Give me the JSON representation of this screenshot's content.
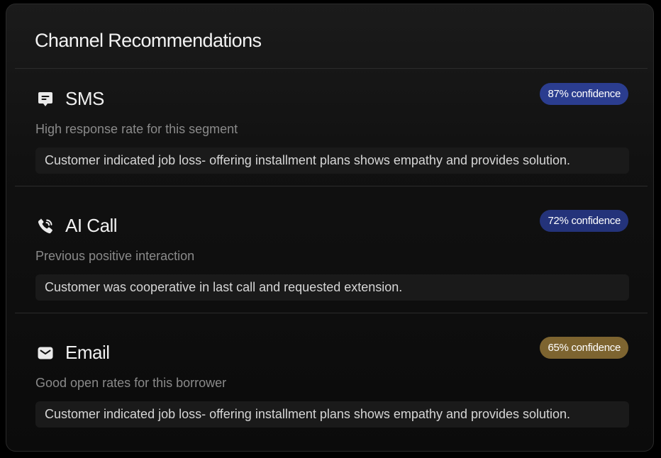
{
  "panel": {
    "title": "Channel Recommendations"
  },
  "recommendations": [
    {
      "channel": "SMS",
      "icon": "chat-bubble-icon",
      "confidence": "87% confidence",
      "confidence_color": "#2b3d8f",
      "reason": "High response rate for this segment",
      "detail": "Customer indicated job loss- offering installment plans shows empathy and provides solution."
    },
    {
      "channel": "AI Call",
      "icon": "phone-call-icon",
      "confidence": "72% confidence",
      "confidence_color": "#24337a",
      "reason": "Previous positive interaction",
      "detail": "Customer was cooperative in last call and requested extension."
    },
    {
      "channel": "Email",
      "icon": "envelope-icon",
      "confidence": "65% confidence",
      "confidence_color": "#7d6430",
      "reason": "Good open rates for this borrower",
      "detail": "Customer indicated job loss- offering installment plans shows empathy and provides solution."
    }
  ]
}
